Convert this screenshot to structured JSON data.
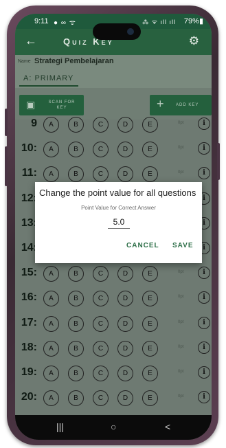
{
  "status_bar": {
    "time": "9:11",
    "notification_icons": "● ∞ ᯤ",
    "signal_icons": "⁂ ᯤ ıll ıll",
    "battery": "79%▮"
  },
  "app_bar": {
    "back_icon": "arrow-left-icon",
    "title": "Quiz Key",
    "settings_icon": "gear-icon"
  },
  "quiz": {
    "name_label": "Name",
    "name_value": "Strategi Pembelajaran"
  },
  "tabs": [
    {
      "label": "A: PRIMARY",
      "selected": true
    }
  ],
  "actions": {
    "scan_label": "SCAN FOR KEY",
    "add_label": "ADD KEY",
    "scan_icon": "camera-icon",
    "add_icon": "plus-icon"
  },
  "options": [
    "A",
    "B",
    "C",
    "D",
    "E"
  ],
  "points_label": "0pt",
  "questions": [
    "9",
    "10:",
    "11:",
    "12:",
    "13:",
    "14:",
    "15:",
    "16:",
    "17:",
    "18:",
    "19:",
    "20:"
  ],
  "dialog": {
    "title": "Change the point value for all questions",
    "subtitle": "Point Value for Correct Answer",
    "value": "5.0",
    "cancel_label": "CANCEL",
    "save_label": "SAVE"
  },
  "navbar": {
    "recent": "|||",
    "home": "○",
    "back": "<"
  },
  "colors": {
    "primary": "#28613f",
    "accent": "#2c6e47",
    "dim_bg": "#6e7a72"
  }
}
